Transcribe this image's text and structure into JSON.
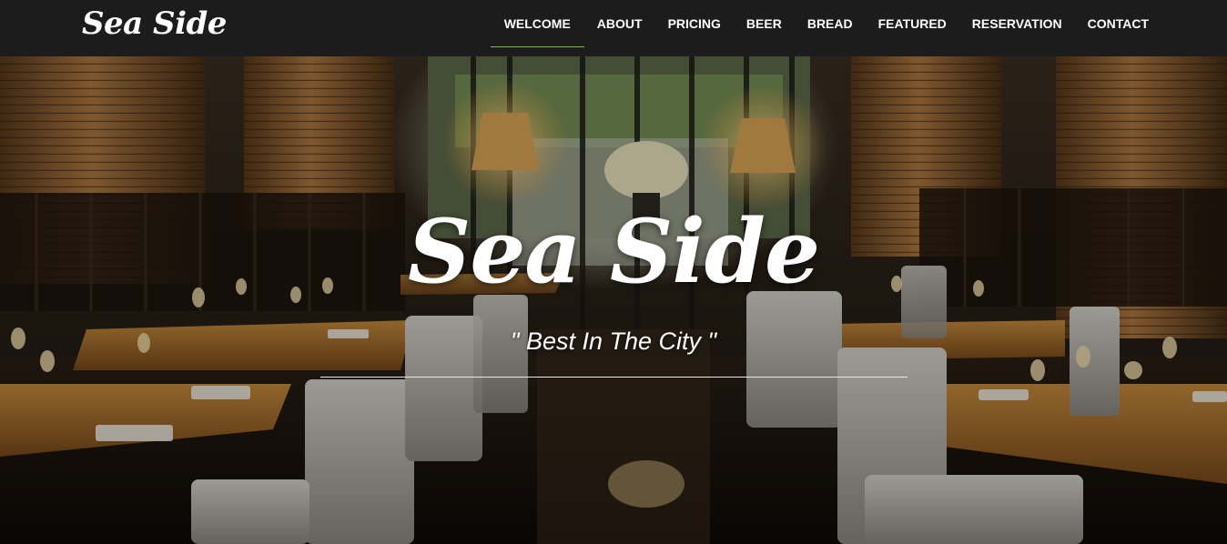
{
  "brand": {
    "name": "Sea Side"
  },
  "nav": {
    "items": [
      {
        "label": "Welcome",
        "active": true
      },
      {
        "label": "About"
      },
      {
        "label": "Pricing"
      },
      {
        "label": "Beer"
      },
      {
        "label": "Bread"
      },
      {
        "label": "Featured"
      },
      {
        "label": "Reservation"
      },
      {
        "label": "Contact"
      }
    ]
  },
  "hero": {
    "title": "Sea Side",
    "tagline": "\" Best In The City \""
  },
  "colors": {
    "navbar_bg": "#1c1c1c",
    "active_underline": "#7cc23a",
    "text": "#ffffff"
  }
}
